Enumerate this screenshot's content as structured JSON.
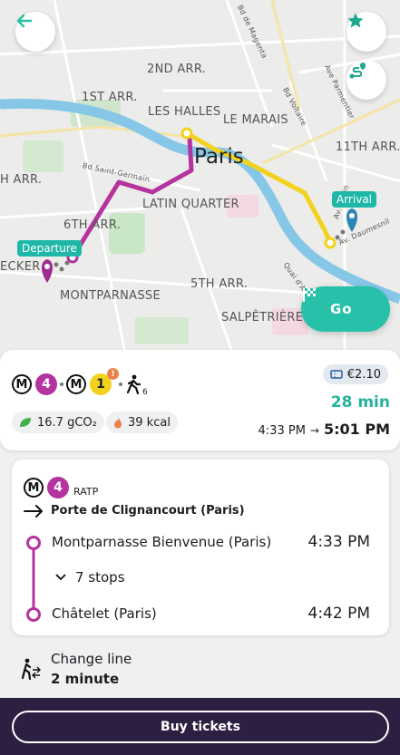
{
  "map": {
    "labels": {
      "arr2": "2ND ARR.",
      "arr1": "1ST ARR.",
      "les_halles": "LES HALLES",
      "le_marais": "LE MARAIS",
      "paris": "Paris",
      "arr11": "11TH ARR.",
      "arr7": "H ARR.",
      "latin": "LATIN QUARTER",
      "arr6": "6TH ARR.",
      "ecker": "ECKER",
      "montparnasse": "MONTPARNASSE",
      "arr5": "5TH ARR.",
      "salpetriere": "SALPÊTRIÈRE",
      "st_bd_voltaire": "Bd Voltaire",
      "st_magenta": "Bd de Magenta",
      "st_parmentier": "Ave Parmentier",
      "st_bd_saint_germain": "Bd Saint-Germain",
      "st_quai": "Quai d'Aust",
      "st_av_rollin": "Av. Rollin",
      "st_daumesnil": "Av. Daumesnil"
    },
    "departure_tag": "Departure",
    "arrival_tag": "Arrival",
    "go_label": "Go"
  },
  "colors": {
    "line4": "#b5339e",
    "line1": "#f2d21c",
    "accent": "#26c1a8",
    "river": "#86c7e8"
  },
  "summary": {
    "line_a": "4",
    "line_b": "1",
    "walk_minutes": "6",
    "co2": "16.7 gCO₂",
    "kcal": "39 kcal",
    "price": "€2.10",
    "duration": "28 min",
    "depart_time": "4:33 PM",
    "arrow": "→",
    "arrive_time": "5:01 PM"
  },
  "detail": {
    "line": "4",
    "operator": "RATP",
    "direction": "Porte de Clignancourt (Paris)",
    "from_stop": "Montparnasse Bienvenue (Paris)",
    "from_time": "4:33 PM",
    "stops": "7 stops",
    "to_stop": "Châtelet (Paris)",
    "to_time": "4:42 PM"
  },
  "change": {
    "title": "Change line",
    "duration": "2 minute"
  },
  "bottom": {
    "buy_label": "Buy tickets"
  }
}
